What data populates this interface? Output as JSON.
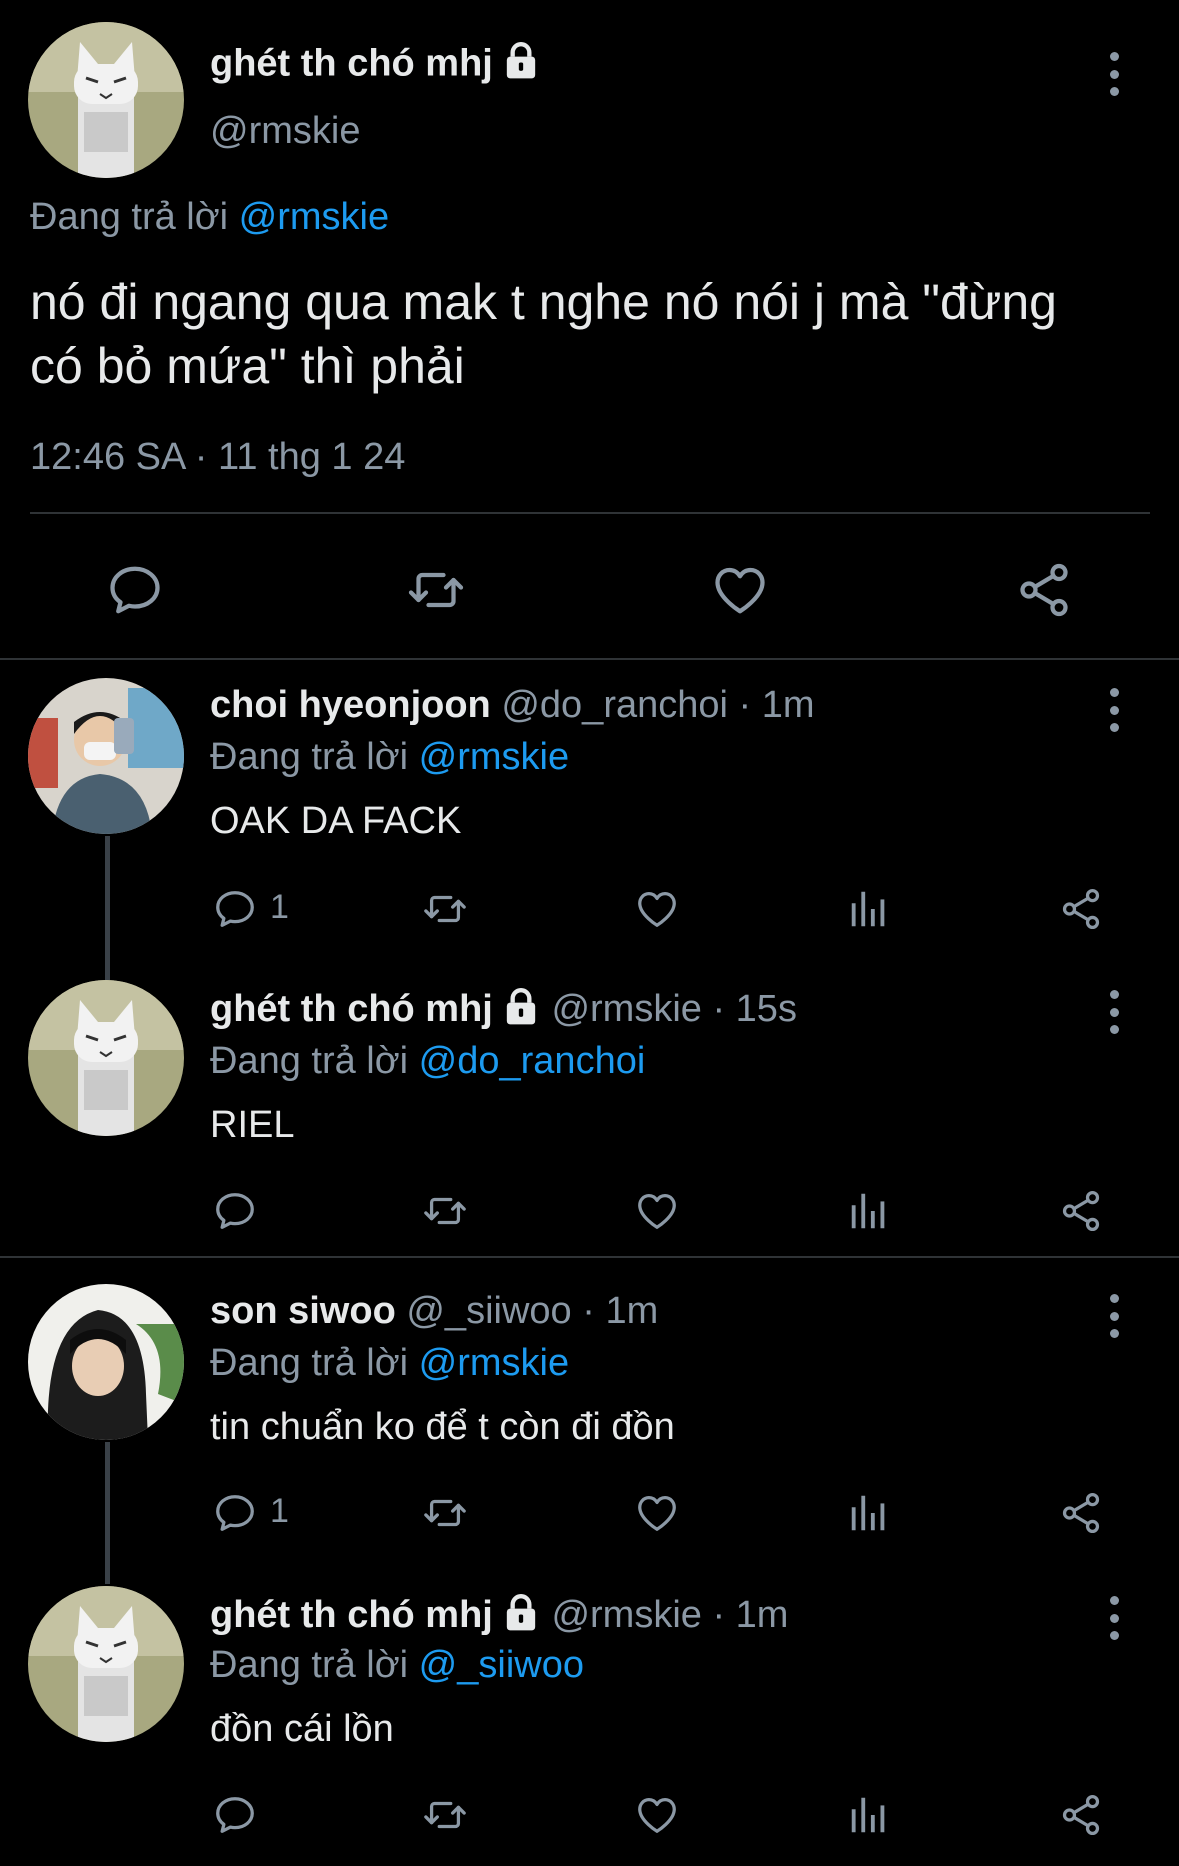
{
  "main_tweet": {
    "name": "ghét th chó mhj",
    "handle": "@rmskie",
    "replying_prefix": "Đang trả lời",
    "replying_to": "@rmskie",
    "text_line1": "nó đi ngang qua mak t nghe nó nói j mà \"đừng",
    "text_line2": "có bỏ mứa\" thì phải",
    "timestamp": "12:46 SA · 11 thg 1 24"
  },
  "replies": [
    {
      "name": "choi hyeonjoon",
      "handle": "@do_ranchoi",
      "time": " · 1m",
      "replying_prefix": "Đang trả lời",
      "replying_to": "@rmskie",
      "text": "OAK DA FACK",
      "reply_count": "1"
    },
    {
      "name": "ghét th chó mhj",
      "handle": "@rmskie",
      "time": " · 15s",
      "replying_prefix": "Đang trả lời",
      "replying_to": "@do_ranchoi",
      "text": "RIEL",
      "reply_count": ""
    },
    {
      "name": "son siwoo",
      "handle": "@_siiwoo",
      "time": " · 1m",
      "replying_prefix": "Đang trả lời",
      "replying_to": "@rmskie",
      "text": "tin chuẩn ko để t còn đi đồn",
      "reply_count": "1"
    },
    {
      "name": "ghét th chó mhj",
      "handle": "@rmskie",
      "time": " · 1m",
      "replying_prefix": "Đang trả lời",
      "replying_to": "@_siiwoo",
      "text": "đồn cái lồn",
      "reply_count": ""
    }
  ],
  "colors": {
    "background": "#000000",
    "text": "#e7e9ea",
    "muted": "#8b98a5",
    "link": "#1d9bf0"
  },
  "icons": [
    "more-icon",
    "lock-icon",
    "reply-icon",
    "retweet-icon",
    "like-icon",
    "share-icon",
    "views-icon"
  ]
}
